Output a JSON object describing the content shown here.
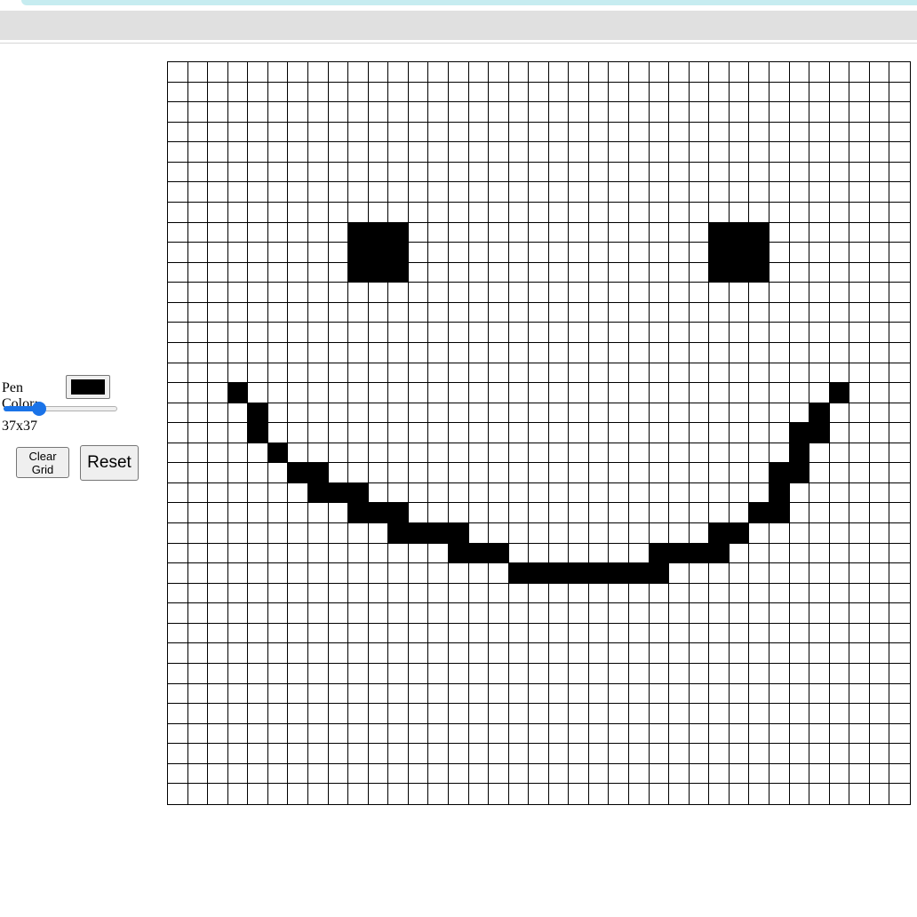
{
  "controls": {
    "pen_color_label": "Pen Color:",
    "pen_color_value": "#000000",
    "grid_size_slider": {
      "value": 37,
      "min": 1,
      "max": 128
    },
    "grid_size_readout": "37x37",
    "clear_grid_label": "Clear\nGrid",
    "reset_label": "Reset"
  },
  "colors": {
    "accent": "#1a73e8",
    "top_accent": "#c6ecf0",
    "toolbar_strip": "#e0e0e0",
    "cell_empty": "#ffffff",
    "cell_line": "#000000"
  },
  "grid": {
    "rows": 37,
    "cols": 37,
    "filled_cells": [
      [
        8,
        9
      ],
      [
        8,
        10
      ],
      [
        8,
        11
      ],
      [
        8,
        27
      ],
      [
        8,
        28
      ],
      [
        8,
        29
      ],
      [
        9,
        9
      ],
      [
        9,
        10
      ],
      [
        9,
        11
      ],
      [
        9,
        27
      ],
      [
        9,
        28
      ],
      [
        9,
        29
      ],
      [
        10,
        9
      ],
      [
        10,
        10
      ],
      [
        10,
        11
      ],
      [
        10,
        27
      ],
      [
        10,
        28
      ],
      [
        10,
        29
      ],
      [
        16,
        3
      ],
      [
        16,
        33
      ],
      [
        17,
        4
      ],
      [
        17,
        32
      ],
      [
        18,
        4
      ],
      [
        18,
        31
      ],
      [
        18,
        32
      ],
      [
        19,
        5
      ],
      [
        19,
        31
      ],
      [
        20,
        6
      ],
      [
        20,
        7
      ],
      [
        20,
        30
      ],
      [
        20,
        31
      ],
      [
        21,
        7
      ],
      [
        21,
        8
      ],
      [
        21,
        9
      ],
      [
        21,
        30
      ],
      [
        22,
        9
      ],
      [
        22,
        10
      ],
      [
        22,
        11
      ],
      [
        22,
        29
      ],
      [
        22,
        30
      ],
      [
        23,
        11
      ],
      [
        23,
        12
      ],
      [
        23,
        13
      ],
      [
        23,
        14
      ],
      [
        23,
        27
      ],
      [
        23,
        28
      ],
      [
        24,
        14
      ],
      [
        24,
        15
      ],
      [
        24,
        16
      ],
      [
        24,
        24
      ],
      [
        24,
        25
      ],
      [
        24,
        26
      ],
      [
        24,
        27
      ],
      [
        25,
        17
      ],
      [
        25,
        18
      ],
      [
        25,
        19
      ],
      [
        25,
        20
      ],
      [
        25,
        21
      ],
      [
        25,
        22
      ],
      [
        25,
        23
      ],
      [
        25,
        24
      ]
    ]
  }
}
